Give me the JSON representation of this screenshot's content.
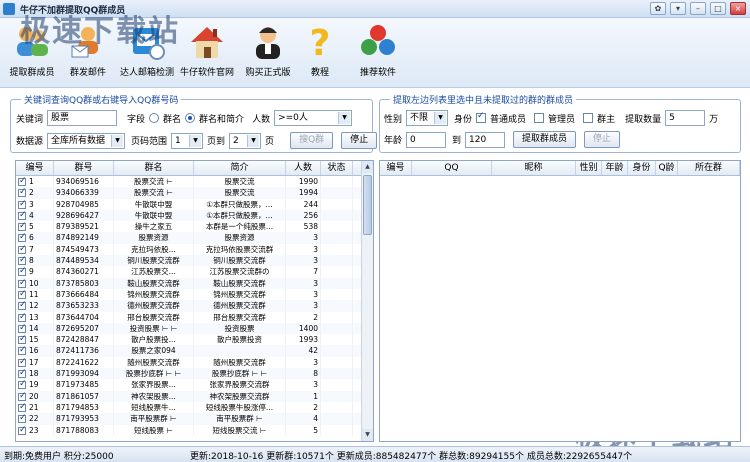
{
  "window": {
    "title": "牛仔不加群提取QQ群成员"
  },
  "toolbar": [
    {
      "label": "提取群成员",
      "icon": "users-icon"
    },
    {
      "label": "群发邮件",
      "icon": "mail-icon"
    },
    {
      "label": "达人邮箱检测",
      "icon": "mailbox-check-icon"
    },
    {
      "label": "牛仔软件官网",
      "icon": "home-icon"
    },
    {
      "label": "购买正式版",
      "icon": "support-icon"
    },
    {
      "label": "教程",
      "icon": "help-icon"
    },
    {
      "label": "推荐软件",
      "icon": "apps-icon"
    }
  ],
  "watermark": "极速下载站",
  "left_panel": {
    "title": "关键词查询QQ群或右键导入QQ群号码",
    "keyword_label": "关键词",
    "keyword_value": "股票",
    "field_label": "字段",
    "opt_name": "群名",
    "opt_name_intro": "群名和简介",
    "people_label": "人数",
    "people_value": ">=0人",
    "source_label": "数据源",
    "source_value": "全库所有数据",
    "page_range_label": "页码范围",
    "page_from": "1",
    "page_to_label": "页到",
    "page_to": "2",
    "page_unit": "页",
    "search_btn": "搜Q群",
    "stop_btn": "停止"
  },
  "right_panel": {
    "title": "提取左边列表里选中且未提取过的群的群成员",
    "gender_label": "性别",
    "gender_value": "不限",
    "identity_label": "身份",
    "opt_normal": "普通成员",
    "opt_admin": "管理员",
    "opt_owner": "群主",
    "extract_count_label": "提取数量",
    "extract_count": "5",
    "extract_unit": "万",
    "age_label": "年龄",
    "age_from": "0",
    "age_to_label": "到",
    "age_to": "120",
    "extract_btn": "提取群成员",
    "stop_btn": "停止"
  },
  "left_grid": {
    "columns": [
      "编号",
      "群号",
      "群名",
      "简介",
      "人数",
      "状态"
    ],
    "rows": [
      [
        "1",
        "934069516",
        "股票交流 ⊢",
        "股票交流",
        "1990",
        ""
      ],
      [
        "2",
        "934066339",
        "股票交流 ⊢",
        "股票交流",
        "1994",
        ""
      ],
      [
        "3",
        "928704985",
        "牛散联中盟",
        "①本群只做股票，...",
        "244",
        ""
      ],
      [
        "4",
        "928696427",
        "牛散联中盟",
        "①本群只做股票，...",
        "256",
        ""
      ],
      [
        "5",
        "879389521",
        "操牛之家五",
        "本群是一个纯股票...",
        "538",
        ""
      ],
      [
        "6",
        "874892149",
        "股票资源",
        "股票资源",
        "3",
        ""
      ],
      [
        "7",
        "874549473",
        "克拉玛依股...",
        "克拉玛依股票交流群",
        "3",
        ""
      ],
      [
        "8",
        "874489534",
        "铜川股票交流群",
        "铜川股票交流群",
        "3",
        ""
      ],
      [
        "9",
        "874360271",
        "江苏股票交...",
        "江苏股票交流群の",
        "7",
        ""
      ],
      [
        "10",
        "873785803",
        "鞍山股票交流群",
        "鞍山股票交流群",
        "3",
        ""
      ],
      [
        "11",
        "873666484",
        "锦州股票交流群",
        "锦州股票交流群",
        "3",
        ""
      ],
      [
        "12",
        "873653233",
        "德州股票交流群",
        "德州股票交流群",
        "3",
        ""
      ],
      [
        "13",
        "873644704",
        "邢台股票交流群",
        "邢台股票交流群",
        "2",
        ""
      ],
      [
        "14",
        "872695207",
        "投资股票 ⊢ ⊢",
        "投资股票",
        "1400",
        ""
      ],
      [
        "15",
        "872428847",
        "散户股票投...",
        "散户股票投资",
        "1993",
        ""
      ],
      [
        "16",
        "872411736",
        "股票之家094",
        "",
        "42",
        ""
      ],
      [
        "17",
        "872241622",
        "随州股票交流群",
        "随州股票交流群",
        "3",
        ""
      ],
      [
        "18",
        "871993094",
        "股票抄底群 ⊢ ⊢",
        "股票抄底群 ⊢ ⊢",
        "8",
        ""
      ],
      [
        "19",
        "871973485",
        "张家界股票...",
        "张家界股票交流群",
        "3",
        ""
      ],
      [
        "20",
        "871861057",
        "神农架股票...",
        "神农架股票交流群",
        "1",
        ""
      ],
      [
        "21",
        "871794853",
        "短线股票牛...",
        "短线股票牛股涨停...",
        "2",
        ""
      ],
      [
        "22",
        "871793953",
        "南平股票群 ⊢",
        "南平股票群 ⊢",
        "4",
        ""
      ],
      [
        "23",
        "871788083",
        "短线股票 ⊢",
        "短线股票交流 ⊢",
        "5",
        ""
      ]
    ]
  },
  "right_grid": {
    "columns": [
      "编号",
      "QQ",
      "昵称",
      "性别",
      "年龄",
      "身份",
      "Q龄",
      "所在群"
    ]
  },
  "status": {
    "user": "到期:免费用户 积分:25000",
    "update": "更新:2018-10-16 更新群:10571个 更新成员:885482477个 群总数:89294155个 成员总数:2292655447个"
  }
}
